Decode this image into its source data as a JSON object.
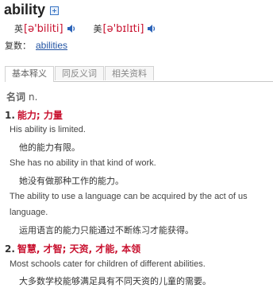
{
  "headword": "ability",
  "pron": {
    "uk_label": "英",
    "uk_ipa": "[ə'biliti]",
    "us_label": "美",
    "us_ipa": "[ə'bɪlɪti]"
  },
  "plural": {
    "label": "复数：",
    "value": "abilities"
  },
  "tabs": [
    "基本释义",
    "同反义词",
    "相关资料"
  ],
  "pos": {
    "name": "名词",
    "abbr": "n."
  },
  "senses": [
    {
      "num": "1.",
      "meaning": "能力; 力量",
      "examples": [
        {
          "en": "His ability is limited.",
          "zh": "他的能力有限。"
        },
        {
          "en": "She has no ability in that kind of work.",
          "zh": "她没有做那种工作的能力。"
        },
        {
          "en": "The ability to use a language can be acquired by the act of us",
          "en2": "language.",
          "zh": "运用语言的能力只能通过不断练习才能获得。"
        }
      ]
    },
    {
      "num": "2.",
      "meaning": "智慧, 才智; 天资, 才能, 本领",
      "examples": [
        {
          "en": "Most schools cater for children of different abilities.",
          "zh": "大多数学校能够满足具有不同天资的儿童的需要。"
        }
      ]
    }
  ],
  "colors": {
    "accent_red": "#c8102e",
    "link_blue": "#2153a3"
  },
  "icons": [
    "expand-plus-icon",
    "speaker-icon"
  ]
}
